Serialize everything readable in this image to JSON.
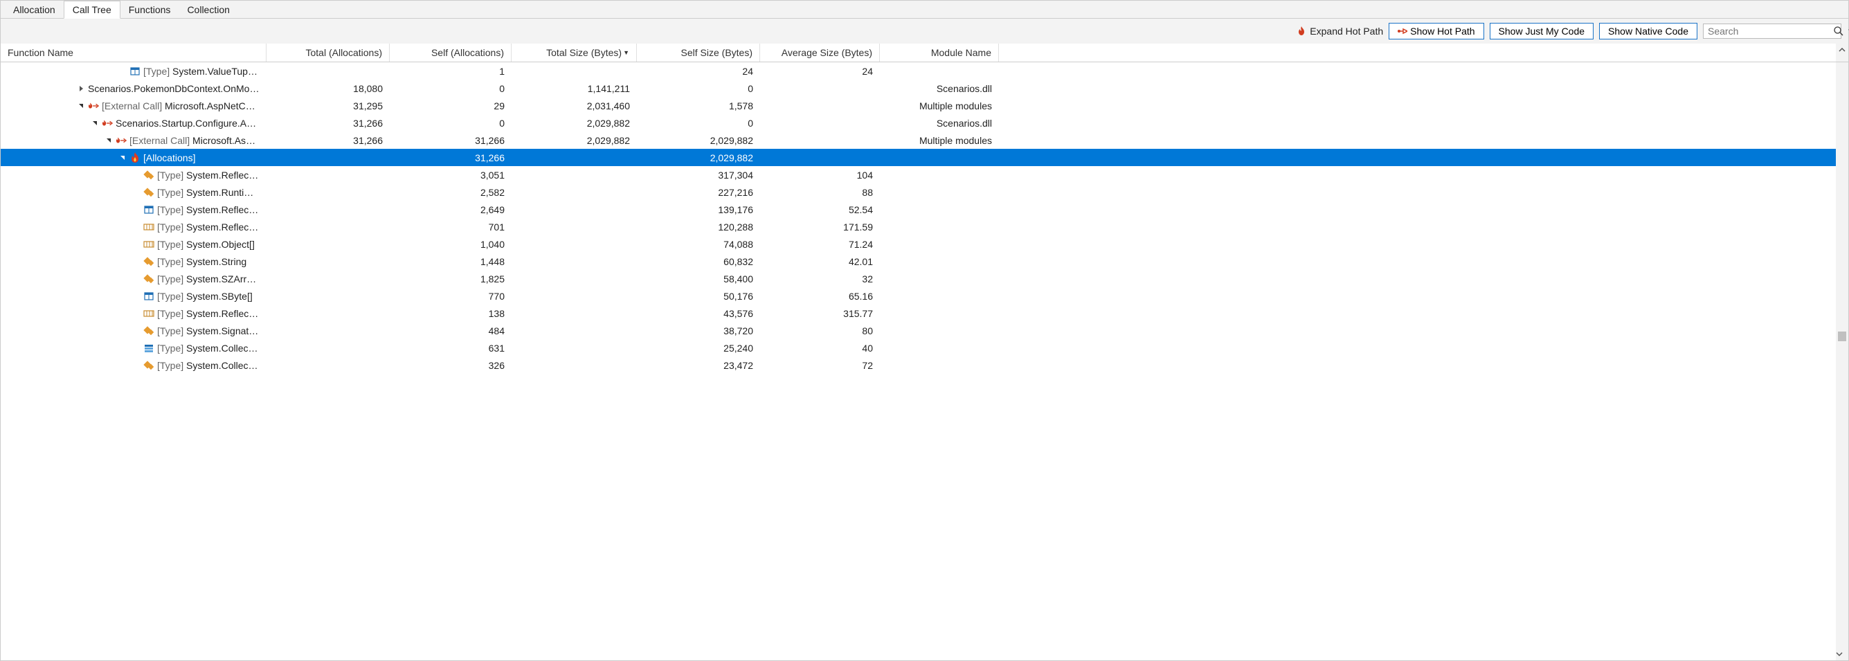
{
  "tabs": [
    {
      "label": "Allocation",
      "active": false
    },
    {
      "label": "Call Tree",
      "active": true
    },
    {
      "label": "Functions",
      "active": false
    },
    {
      "label": "Collection",
      "active": false
    }
  ],
  "toolbar": {
    "expand_hot_path": "Expand Hot Path",
    "show_hot_path": "Show Hot Path",
    "show_just_my_code": "Show Just My Code",
    "show_native_code": "Show Native Code",
    "search_placeholder": "Search"
  },
  "columns": {
    "name": "Function Name",
    "total_alloc": "Total (Allocations)",
    "self_alloc": "Self (Allocations)",
    "total_size": "Total Size (Bytes)",
    "self_size": "Self Size (Bytes)",
    "avg_size": "Average Size (Bytes)",
    "module": "Module Name"
  },
  "rows": [
    {
      "indent": 8,
      "expander": "",
      "icons": [
        "struct"
      ],
      "prefix": "[Type] ",
      "name": "System.ValueTuple<Syste...",
      "total_alloc": "",
      "self_alloc": "1",
      "total_size": "",
      "self_size": "24",
      "avg_size": "24",
      "module": "",
      "selected": false
    },
    {
      "indent": 5,
      "expander": "collapsed",
      "icons": [],
      "prefix": "",
      "name": "Scenarios.PokemonDbContext.OnMod...",
      "total_alloc": "18,080",
      "self_alloc": "0",
      "total_size": "1,141,211",
      "self_size": "0",
      "avg_size": "",
      "module": "Scenarios.dll",
      "selected": false
    },
    {
      "indent": 5,
      "expander": "expanded",
      "icons": [
        "flame-arrow"
      ],
      "prefix": "[External Call] ",
      "name": "Microsoft.AspNetCore....",
      "total_alloc": "31,295",
      "self_alloc": "29",
      "total_size": "2,031,460",
      "self_size": "1,578",
      "avg_size": "",
      "module": "Multiple modules",
      "selected": false
    },
    {
      "indent": 6,
      "expander": "expanded",
      "icons": [
        "flame-arrow"
      ],
      "prefix": "",
      "name": "Scenarios.Startup.Configure.Anony...",
      "total_alloc": "31,266",
      "self_alloc": "0",
      "total_size": "2,029,882",
      "self_size": "0",
      "avg_size": "",
      "module": "Scenarios.dll",
      "selected": false
    },
    {
      "indent": 7,
      "expander": "expanded",
      "icons": [
        "flame-arrow"
      ],
      "prefix": "[External Call] ",
      "name": "Microsoft.AspNetC...",
      "total_alloc": "31,266",
      "self_alloc": "31,266",
      "total_size": "2,029,882",
      "self_size": "2,029,882",
      "avg_size": "",
      "module": "Multiple modules",
      "selected": false
    },
    {
      "indent": 8,
      "expander": "expanded",
      "icons": [
        "flame"
      ],
      "prefix": "",
      "name": "[Allocations]",
      "total_alloc": "",
      "self_alloc": "31,266",
      "total_size": "",
      "self_size": "2,029,882",
      "avg_size": "",
      "module": "",
      "selected": true
    },
    {
      "indent": 9,
      "expander": "",
      "icons": [
        "class"
      ],
      "prefix": "[Type] ",
      "name": "System.Reflection.Run...",
      "total_alloc": "",
      "self_alloc": "3,051",
      "total_size": "",
      "self_size": "317,304",
      "avg_size": "104",
      "module": "",
      "selected": false
    },
    {
      "indent": 9,
      "expander": "",
      "icons": [
        "class"
      ],
      "prefix": "[Type] ",
      "name": "System.RuntimeMeth...",
      "total_alloc": "",
      "self_alloc": "2,582",
      "total_size": "",
      "self_size": "227,216",
      "avg_size": "88",
      "module": "",
      "selected": false
    },
    {
      "indent": 9,
      "expander": "",
      "icons": [
        "struct"
      ],
      "prefix": "[Type] ",
      "name": "System.Reflection.Cus...",
      "total_alloc": "",
      "self_alloc": "2,649",
      "total_size": "",
      "self_size": "139,176",
      "avg_size": "52.54",
      "module": "",
      "selected": false
    },
    {
      "indent": 9,
      "expander": "",
      "icons": [
        "array"
      ],
      "prefix": "[Type] ",
      "name": "System.Reflection.Run...",
      "total_alloc": "",
      "self_alloc": "701",
      "total_size": "",
      "self_size": "120,288",
      "avg_size": "171.59",
      "module": "",
      "selected": false
    },
    {
      "indent": 9,
      "expander": "",
      "icons": [
        "array"
      ],
      "prefix": "[Type] ",
      "name": "System.Object[]",
      "total_alloc": "",
      "self_alloc": "1,040",
      "total_size": "",
      "self_size": "74,088",
      "avg_size": "71.24",
      "module": "",
      "selected": false
    },
    {
      "indent": 9,
      "expander": "",
      "icons": [
        "class"
      ],
      "prefix": "[Type] ",
      "name": "System.String",
      "total_alloc": "",
      "self_alloc": "1,448",
      "total_size": "",
      "self_size": "60,832",
      "avg_size": "42.01",
      "module": "",
      "selected": false
    },
    {
      "indent": 9,
      "expander": "",
      "icons": [
        "class"
      ],
      "prefix": "[Type] ",
      "name": "System.SZArrayEnum...",
      "total_alloc": "",
      "self_alloc": "1,825",
      "total_size": "",
      "self_size": "58,400",
      "avg_size": "32",
      "module": "",
      "selected": false
    },
    {
      "indent": 9,
      "expander": "",
      "icons": [
        "struct"
      ],
      "prefix": "[Type] ",
      "name": "System.SByte[]",
      "total_alloc": "",
      "self_alloc": "770",
      "total_size": "",
      "self_size": "50,176",
      "avg_size": "65.16",
      "module": "",
      "selected": false
    },
    {
      "indent": 9,
      "expander": "",
      "icons": [
        "array"
      ],
      "prefix": "[Type] ",
      "name": "System.Reflection.Me...",
      "total_alloc": "",
      "self_alloc": "138",
      "total_size": "",
      "self_size": "43,576",
      "avg_size": "315.77",
      "module": "",
      "selected": false
    },
    {
      "indent": 9,
      "expander": "",
      "icons": [
        "class"
      ],
      "prefix": "[Type] ",
      "name": "System.Signature",
      "total_alloc": "",
      "self_alloc": "484",
      "total_size": "",
      "self_size": "38,720",
      "avg_size": "80",
      "module": "",
      "selected": false
    },
    {
      "indent": 9,
      "expander": "",
      "icons": [
        "enum"
      ],
      "prefix": "[Type] ",
      "name": "System.Collections.Ge...",
      "total_alloc": "",
      "self_alloc": "631",
      "total_size": "",
      "self_size": "25,240",
      "avg_size": "40",
      "module": "",
      "selected": false
    },
    {
      "indent": 9,
      "expander": "",
      "icons": [
        "class"
      ],
      "prefix": "[Type] ",
      "name": "System.Collections.Ge...",
      "total_alloc": "",
      "self_alloc": "326",
      "total_size": "",
      "self_size": "23,472",
      "avg_size": "72",
      "module": "",
      "selected": false
    }
  ]
}
